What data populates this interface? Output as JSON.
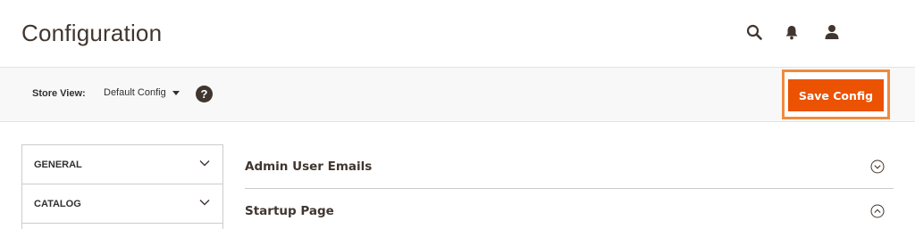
{
  "header": {
    "title": "Configuration",
    "icons": [
      "search-icon",
      "notifications-icon",
      "user-account-icon"
    ]
  },
  "toolbar": {
    "store_view_label": "Store View:",
    "store_view_value": "Default Config",
    "help_icon": "?",
    "save_label": "Save Config"
  },
  "sidebar": {
    "items": [
      {
        "label": "GENERAL",
        "icon": "chevron-down-icon"
      },
      {
        "label": "CATALOG",
        "icon": "chevron-down-icon"
      }
    ]
  },
  "main": {
    "sections": [
      {
        "title": "Admin User Emails",
        "state_icon": "circle-chevron-down-icon"
      },
      {
        "title": "Startup Page",
        "state_icon": "circle-chevron-up-icon"
      }
    ]
  },
  "colors": {
    "accent": "#eb5202",
    "highlight": "#f08a3c",
    "title": "#41362f",
    "toolbar_bg": "#f8f8f8"
  }
}
